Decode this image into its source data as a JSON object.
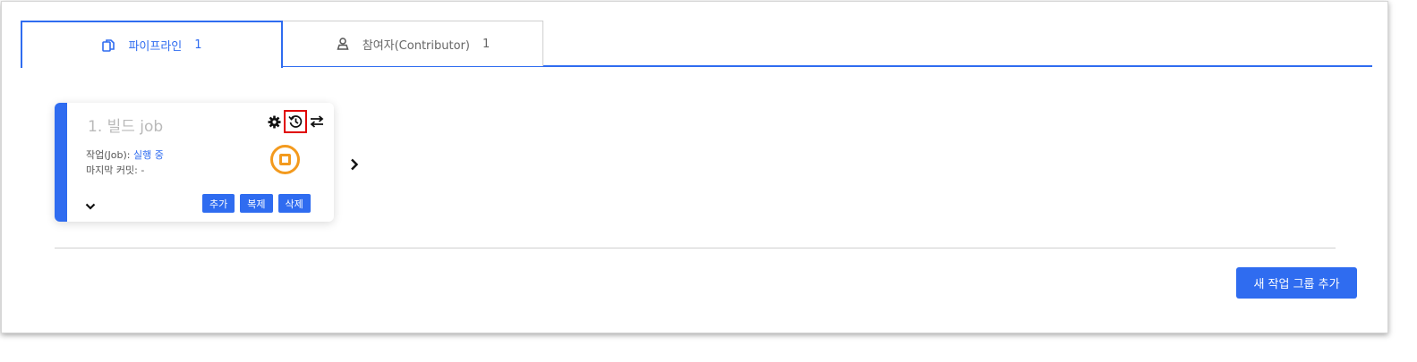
{
  "tabs": [
    {
      "label": "파이프라인",
      "count": "1",
      "icon": "copy-icon",
      "active": true
    },
    {
      "label": "참여자(Contributor)",
      "count": "1",
      "icon": "user-icon",
      "active": false
    }
  ],
  "job_card": {
    "title": "1. 빌드 job",
    "job_label": "작업(Job):",
    "job_status": "실행 중",
    "commit_label": "마지막 커밋:",
    "commit_value": "-",
    "tools": [
      "gear-icon",
      "history-icon",
      "swap-icon"
    ],
    "status_icon": "stop-circle-icon",
    "buttons": {
      "add": "추가",
      "copy": "복제",
      "delete": "삭제"
    }
  },
  "add_group_button": "새 작업 그룹 추가",
  "colors": {
    "accent": "#2f6cf0",
    "running": "#f39a1e",
    "highlight": "#e00000"
  }
}
